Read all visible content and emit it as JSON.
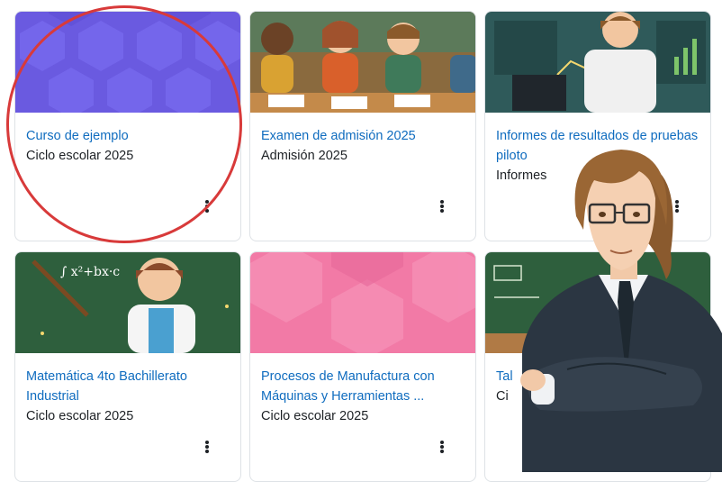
{
  "courses": [
    {
      "title": "Curso de ejemplo",
      "subtitle": "Ciclo escolar 2025"
    },
    {
      "title": "Examen de admisión 2025",
      "subtitle": "Admisión 2025"
    },
    {
      "title": "Informes de resultados de pruebas piloto",
      "subtitle": "Informes"
    },
    {
      "title": "Matemática 4to Bachillerato Industrial",
      "subtitle": "Ciclo escolar 2025"
    },
    {
      "title": "Procesos de Manufactura con Máquinas y Herramientas ...",
      "subtitle": "Ciclo escolar 2025"
    },
    {
      "title": "Tal",
      "subtitle": "Ci"
    }
  ],
  "board": {
    "formula": "∫ x²+bx·c"
  },
  "colors": {
    "link": "#0f6cbf",
    "highlight_circle": "#d83a3a",
    "purple_pattern": "#6a5ae0",
    "pink_pattern": "#f27aa6"
  }
}
